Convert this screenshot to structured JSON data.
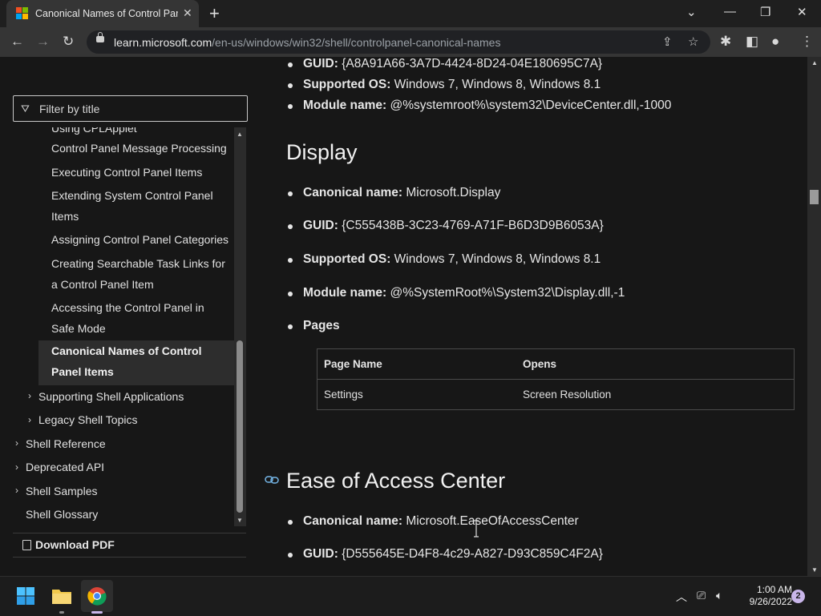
{
  "browser": {
    "tab_title": "Canonical Names of Control Panel Items",
    "url_domain": "learn.microsoft.com",
    "url_path": "/en-us/windows/win32/shell/controlpanel-canonical-names",
    "icons": [
      "windows-logo-icon",
      "close-icon",
      "new-tab-icon",
      "chevron-down-icon",
      "minimize-icon",
      "restore-icon",
      "close-window-icon",
      "back-icon",
      "forward-icon",
      "reload-icon",
      "lock-icon",
      "share-icon",
      "star-icon",
      "extensions-icon",
      "side-panel-icon",
      "profile-icon",
      "menu-icon"
    ]
  },
  "sidebar": {
    "filter_placeholder": "Filter by title",
    "items": [
      {
        "label": "Using CPLApplet"
      },
      {
        "label": "Control Panel Message Processing"
      },
      {
        "label": "Executing Control Panel Items"
      },
      {
        "label": "Extending System Control Panel Items"
      },
      {
        "label": "Assigning Control Panel Categories"
      },
      {
        "label": "Creating Searchable Task Links for a Control Panel Item"
      },
      {
        "label": "Accessing the Control Panel in Safe Mode"
      },
      {
        "label": "Canonical Names of Control Panel Items"
      },
      {
        "label": "Supporting Shell Applications"
      },
      {
        "label": "Legacy Shell Topics"
      },
      {
        "label": "Shell Reference"
      },
      {
        "label": "Deprecated API"
      },
      {
        "label": "Shell Samples"
      },
      {
        "label": "Shell Glossary"
      }
    ],
    "download_pdf": "Download PDF"
  },
  "content": {
    "prev": {
      "guid_label": "GUID:",
      "guid": "{A8A91A66-3A7D-4424-8D24-04E180695C7A}",
      "os_label": "Supported OS:",
      "os": "Windows 7, Windows 8, Windows 8.1",
      "module_label": "Module name:",
      "module": "@%systemroot%\\system32\\DeviceCenter.dll,-1000"
    },
    "display": {
      "heading": "Display",
      "canonical_label": "Canonical name:",
      "canonical": "Microsoft.Display",
      "guid_label": "GUID:",
      "guid": "{C555438B-3C23-4769-A71F-B6D3D9B6053A}",
      "os_label": "Supported OS:",
      "os": "Windows 7, Windows 8, Windows 8.1",
      "module_label": "Module name:",
      "module": "@%SystemRoot%\\System32\\Display.dll,-1",
      "pages_label": "Pages",
      "table": {
        "headers": [
          "Page Name",
          "Opens"
        ],
        "rows": [
          [
            "Settings",
            "Screen Resolution"
          ]
        ]
      }
    },
    "ease": {
      "heading": "Ease of Access Center",
      "canonical_label": "Canonical name:",
      "canonical": "Microsoft.EaseOfAccessCenter",
      "guid_label": "GUID:",
      "guid": "{D555645E-D4F8-4c29-A827-D93C859C4F2A}"
    }
  },
  "taskbar": {
    "time": "1:00 AM",
    "date": "9/26/2022",
    "notifications": "2",
    "apps": [
      "start-icon",
      "file-explorer-icon",
      "chrome-icon"
    ]
  },
  "colors": {
    "accent": "#75b6e7",
    "notif": "#c9b6ea"
  }
}
